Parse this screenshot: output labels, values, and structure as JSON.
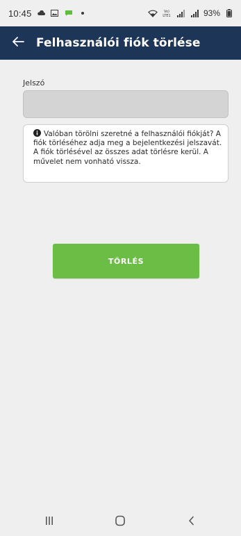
{
  "status_bar": {
    "time": "10:45",
    "battery": "93%",
    "icons": [
      "cloud-icon",
      "image-icon",
      "sms-icon",
      "dot-icon",
      "wifi-icon",
      "volte-icon",
      "signal-icon",
      "signal-icon",
      "battery-icon"
    ]
  },
  "header": {
    "back_icon": "arrow-left-icon",
    "title": "Felhasználói fiók törlése",
    "background": "#1d3557"
  },
  "form": {
    "password_label": "Jelszó",
    "password_value": "",
    "password_placeholder": ""
  },
  "info": {
    "icon": "info-icon",
    "text": "Valóban törölni szeretné a felhasználói fiókját? A fiók törléséhez adja meg a bejelentkezési jelszavát. A fiók törlésével az összes adat törlésre kerül. A művelet nem vonható vissza."
  },
  "actions": {
    "delete_label": "TÖRLÉS",
    "delete_color": "#6cbd45"
  },
  "nav_bar": {
    "icons": [
      "recent-apps-icon",
      "home-icon",
      "back-icon"
    ]
  }
}
